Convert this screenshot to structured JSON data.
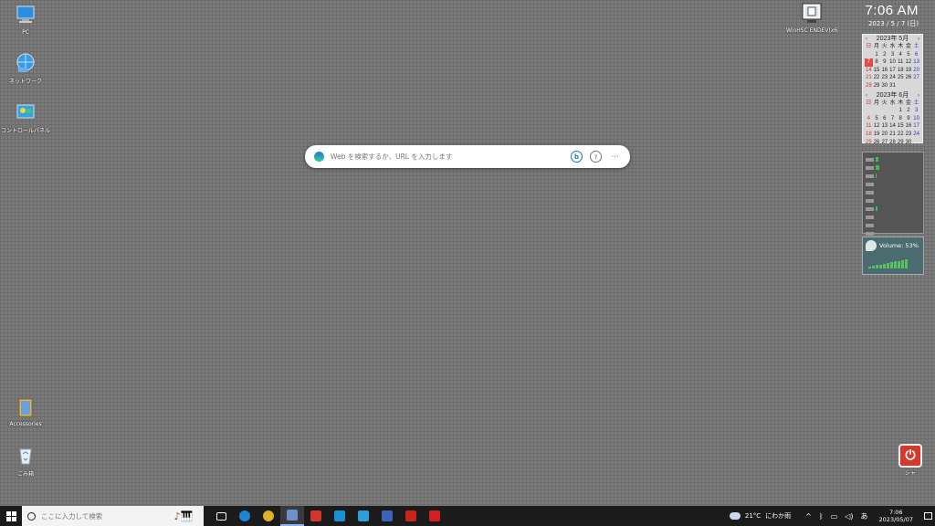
{
  "desktop": {
    "icons": [
      {
        "label": "PC"
      },
      {
        "label": "ネットワーク"
      },
      {
        "label": "コントロールパネル"
      },
      {
        "label": "Accessories"
      },
      {
        "label": "ごみ箱"
      },
      {
        "label": "WinHSC ENDEV(x64)"
      }
    ],
    "power_label": "シャ"
  },
  "clock": {
    "time": "7:06 AM",
    "date": "2023 / 5 / 7 (日)"
  },
  "calendar": {
    "weekday_headers": [
      "日",
      "月",
      "火",
      "水",
      "木",
      "金",
      "土"
    ],
    "months": [
      {
        "title": "2023年 5月",
        "days": [
          "",
          "1",
          "2",
          "3",
          "4",
          "5",
          "6",
          "7",
          "8",
          "9",
          "10",
          "11",
          "12",
          "13",
          "14",
          "15",
          "16",
          "17",
          "18",
          "19",
          "20",
          "21",
          "22",
          "23",
          "24",
          "25",
          "26",
          "27",
          "28",
          "29",
          "30",
          "31",
          "",
          "",
          ""
        ],
        "today": "7"
      },
      {
        "title": "2023年 6月",
        "days": [
          "",
          "",
          "",
          "",
          "1",
          "2",
          "3",
          "4",
          "5",
          "6",
          "7",
          "8",
          "9",
          "10",
          "11",
          "12",
          "13",
          "14",
          "15",
          "16",
          "17",
          "18",
          "19",
          "20",
          "21",
          "22",
          "23",
          "24",
          "25",
          "26",
          "27",
          "28",
          "29",
          "30",
          ""
        ],
        "today": ""
      }
    ]
  },
  "volume": {
    "label": "Volume: 53%",
    "level": 0.53
  },
  "meter": {
    "levels": [
      0.05,
      0.08,
      0.02,
      0.0,
      0.0,
      0.0,
      0.03,
      0.0,
      0.0,
      0.0,
      0.0,
      0.25
    ]
  },
  "browser_search": {
    "placeholder": "Web を検索するか、URL を入力します",
    "bing_icon": "b",
    "help_icon": "?",
    "more_icon": "···"
  },
  "taskbar": {
    "search_placeholder": "ここに入力して検索",
    "apps": [
      {
        "name": "task-view",
        "color": "#1b1b1b"
      },
      {
        "name": "edge",
        "color": "#1e84d4"
      },
      {
        "name": "chrome",
        "color": "#e0b02a"
      },
      {
        "name": "app-active",
        "color": "#6f8fc7"
      },
      {
        "name": "red-app",
        "color": "#d4352c"
      },
      {
        "name": "blue-app",
        "color": "#1a8fd6"
      },
      {
        "name": "store",
        "color": "#2a9fd8"
      },
      {
        "name": "monitor-app",
        "color": "#3a64b8"
      },
      {
        "name": "red-app-2",
        "color": "#c8241c"
      },
      {
        "name": "ty-app",
        "color": "#d22020"
      }
    ],
    "weather_temp": "21°C",
    "weather_text": "にわか雨",
    "ime": "あ",
    "time": "7:06",
    "date": "2023/05/07"
  }
}
